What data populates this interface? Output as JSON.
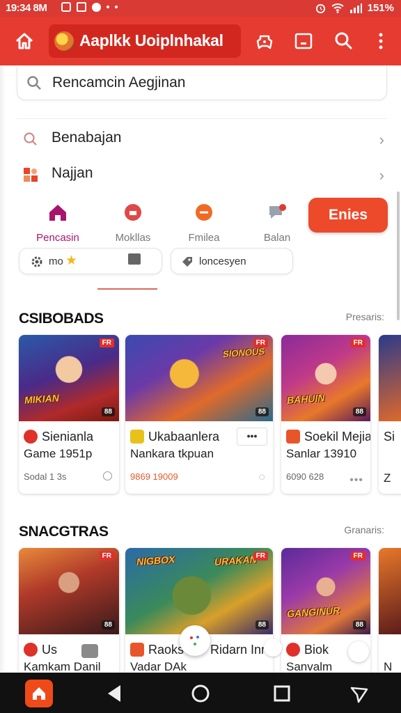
{
  "status_bar": {
    "time": "19:34 8M",
    "battery": "151%"
  },
  "app_bar": {
    "title": "Aaplkk Uoiplnhakal"
  },
  "search": {
    "placeholder": "Rencamcin Aegjinan"
  },
  "list": [
    {
      "label": "Benabajan"
    },
    {
      "label": "Najjan"
    }
  ],
  "quick_nav": [
    {
      "label": "Pencasin",
      "active": true
    },
    {
      "label": "Mokllas",
      "active": false
    },
    {
      "label": "Fmilea",
      "active": false
    },
    {
      "label": "Balan",
      "active": false
    }
  ],
  "cta_label": "Enies",
  "chips": [
    {
      "label": "mo"
    },
    {
      "label": ""
    },
    {
      "label": "loncesyen"
    }
  ],
  "sections": [
    {
      "title": "CSIBOBADS",
      "link": "Presaris:",
      "cards": [
        {
          "art_title": "MIKIAN",
          "badge": "FR",
          "count": "88",
          "title1": "Sienianla",
          "title2": "Game 1951p",
          "meta": "Sodal 1 3s"
        },
        {
          "art_title": "SIONOUS",
          "badge": "FR",
          "count": "88",
          "title1": "Ukabaanlera",
          "title2": "Nankara tkpuan",
          "meta": "9869 19009"
        },
        {
          "art_title": "BAHUIN",
          "badge": "FR",
          "count": "88",
          "title1": "Soekil Mejia",
          "title2": "Sanlar 13910",
          "meta": "6090 628"
        },
        {
          "title1": "Si",
          "title2": "Z"
        }
      ]
    },
    {
      "title": "SNACGTRAS",
      "link": "Granaris:",
      "cards": [
        {
          "badge": "FR",
          "count": "88",
          "title1": "Us",
          "title2": "Kamkam Danil"
        },
        {
          "art_title": "NIGBOX",
          "art_title2": "URAKAN",
          "badge": "FR",
          "count": "88",
          "title1": "Raoks",
          "title1b": "Ridarn Inr",
          "title2": "Vadar DAk"
        },
        {
          "art_title": "GANGINUR",
          "badge": "FR",
          "count": "88",
          "title1": "Biok",
          "title2": "Sanvalm"
        },
        {
          "title1": "",
          "title2": "N"
        }
      ]
    }
  ],
  "colors": {
    "brand": "#e63b30",
    "cta": "#ec4a2a",
    "active_tab": "#a8156c"
  }
}
